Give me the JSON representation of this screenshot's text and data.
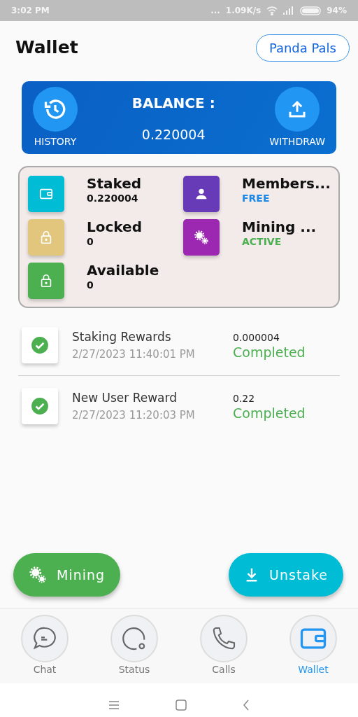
{
  "status_bar": {
    "time": "3:02 PM",
    "dots": "...",
    "speed": "1.09K/s",
    "battery": "94%"
  },
  "header": {
    "title": "Wallet",
    "button": "Panda Pals"
  },
  "balance": {
    "title": "BALANCE :",
    "amount": "0.220004",
    "left_action": "HISTORY",
    "right_action": "WITHDRAW"
  },
  "stats": [
    {
      "kind": "amount",
      "icon": {
        "kind": "wallet",
        "color": "#00bcd4"
      },
      "label": "Staked",
      "value": "0.220004"
    },
    {
      "kind": "membership",
      "icon": {
        "kind": "person",
        "color": "#673ab7"
      },
      "label": "Members...",
      "value": "FREE"
    },
    {
      "kind": "amount",
      "icon": {
        "kind": "lock",
        "color": "#e2c67e"
      },
      "label": "Locked",
      "value": "0"
    },
    {
      "kind": "mining",
      "icon": {
        "kind": "gears",
        "color": "#9c27b0"
      },
      "label": "Mining ...",
      "value": "ACTIVE"
    },
    {
      "kind": "amount",
      "icon": {
        "kind": "lock",
        "color": "#4caf50"
      },
      "label": "Available",
      "value": "0"
    }
  ],
  "transactions": [
    {
      "title": "Staking Rewards",
      "date": "2/27/2023 11:40:01 PM",
      "amount": "0.000004",
      "status": "Completed"
    },
    {
      "title": "New User Reward",
      "date": "2/27/2023 11:20:03 PM",
      "amount": "0.22",
      "status": "Completed"
    }
  ],
  "actions": [
    {
      "kind": "mining",
      "label": "Mining"
    },
    {
      "kind": "unstake",
      "label": "Unstake"
    }
  ],
  "nav": [
    {
      "kind": "chat",
      "label": "Chat",
      "selected": false
    },
    {
      "kind": "status",
      "label": "Status",
      "selected": false
    },
    {
      "kind": "calls",
      "label": "Calls",
      "selected": false
    },
    {
      "kind": "wallet",
      "label": "Wallet",
      "selected": true
    }
  ]
}
